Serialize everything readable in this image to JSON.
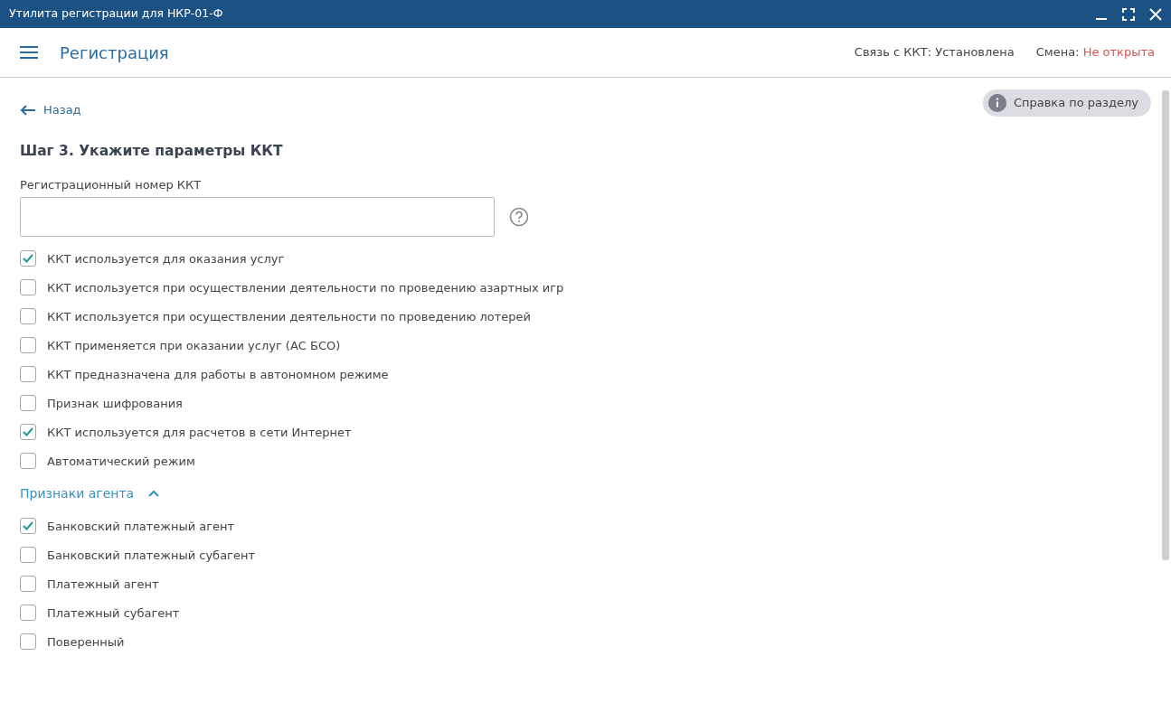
{
  "window": {
    "title": "Утилита регистрации для НКР-01-Ф"
  },
  "header": {
    "title": "Регистрация",
    "connection": "Связь с ККТ: Установлена",
    "shift_label": "Смена:",
    "shift_value": "Не открыта"
  },
  "back_link": "Назад",
  "help_button": "Справка по разделу",
  "step_title": "Шаг 3. Укажите параметры ККТ",
  "reg_number": {
    "label": "Регистрационный номер ККТ"
  },
  "options": [
    {
      "label": "ККТ используется для оказания услуг",
      "checked": true
    },
    {
      "label": "ККТ используется при осуществлении деятельности по проведению азартных игр",
      "checked": false
    },
    {
      "label": "ККТ используется при осуществлении деятельности по проведению лотерей",
      "checked": false
    },
    {
      "label": "ККТ применяется при оказании услуг (АС БСО)",
      "checked": false
    },
    {
      "label": "ККТ предназначена для работы в автономном режиме",
      "checked": false
    },
    {
      "label": "Признак шифрования",
      "checked": false
    },
    {
      "label": "ККТ используется для расчетов в сети Интернет",
      "checked": true
    },
    {
      "label": "Автоматический режим",
      "checked": false
    }
  ],
  "agent_section": {
    "title": "Признаки агента",
    "expanded": true,
    "items": [
      {
        "label": "Банковский платежный агент",
        "checked": true
      },
      {
        "label": "Банковский платежный субагент",
        "checked": false
      },
      {
        "label": "Платежный агент",
        "checked": false
      },
      {
        "label": "Платежный субагент",
        "checked": false
      },
      {
        "label": "Поверенный",
        "checked": false
      }
    ]
  }
}
